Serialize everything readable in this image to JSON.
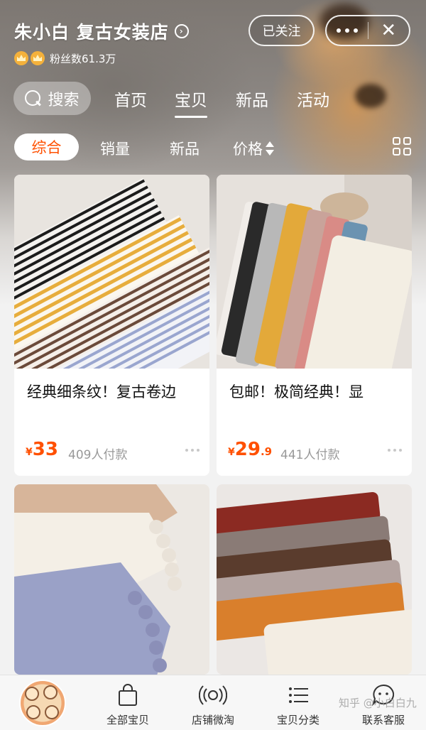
{
  "shop": {
    "name": "朱小白 复古女装店",
    "fans": "粉丝数61.3万",
    "follow_label": "已关注"
  },
  "main_nav": {
    "search_label": "搜索",
    "tabs": [
      {
        "label": "首页"
      },
      {
        "label": "宝贝"
      },
      {
        "label": "新品"
      },
      {
        "label": "活动"
      }
    ],
    "active_tab": "宝贝"
  },
  "sub_nav": {
    "tabs": [
      {
        "label": "综合"
      },
      {
        "label": "销量"
      },
      {
        "label": "新品"
      },
      {
        "label": "价格"
      }
    ],
    "active_tab": "综合"
  },
  "products": [
    {
      "name": "经典细条纹！复古卷边",
      "currency": "¥",
      "price_int": "33",
      "price_dec": "",
      "sold": "409人付款"
    },
    {
      "name": "包邮！极简经典！显",
      "currency": "¥",
      "price_int": "29",
      "price_dec": ".9",
      "sold": "441人付款"
    },
    {
      "name": "",
      "currency": "",
      "price_int": "",
      "price_dec": "",
      "sold": ""
    },
    {
      "name": "",
      "currency": "",
      "price_int": "",
      "price_dec": "",
      "sold": ""
    }
  ],
  "bottom_bar": {
    "items": [
      {
        "label": "全部宝贝",
        "icon": "bag-icon"
      },
      {
        "label": "店铺微淘",
        "icon": "broadcast-icon"
      },
      {
        "label": "宝贝分类",
        "icon": "list-icon"
      },
      {
        "label": "联系客服",
        "icon": "chat-face-icon"
      }
    ],
    "watermark": "知乎 @小白白九"
  },
  "colors": {
    "accent": "#ff5000",
    "price": "#ff5000",
    "muted": "#999999"
  }
}
